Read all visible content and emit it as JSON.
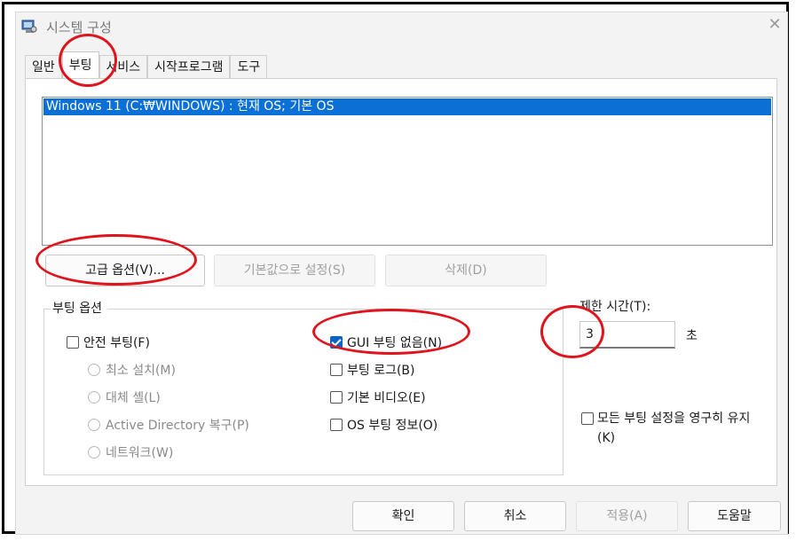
{
  "window": {
    "title": "시스템 구성"
  },
  "tabs": [
    "일반",
    "부팅",
    "서비스",
    "시작프로그램",
    "도구"
  ],
  "active_tab": "부팅",
  "os_list": {
    "items": [
      "Windows 11 (C:₩WINDOWS) : 현재 OS; 기본 OS"
    ]
  },
  "buttons": {
    "advanced": "고급 옵션(V)...",
    "set_default": "기본값으로 설정(S)",
    "delete": "삭제(D)"
  },
  "boot_options": {
    "label": "부팅 옵션",
    "safe_boot": "안전 부팅(F)",
    "minimal": "최소 설치(M)",
    "alternate_shell": "대체 셸(L)",
    "ad_repair": "Active Directory 복구(P)",
    "network": "네트워크(W)",
    "no_gui_boot": "GUI 부팅 없음(N)",
    "boot_log": "부팅 로그(B)",
    "base_video": "기본 비디오(E)",
    "os_boot_info": "OS 부팅 정보(O)"
  },
  "checked": {
    "safe_boot": false,
    "no_gui_boot": true,
    "boot_log": false,
    "base_video": false,
    "os_boot_info": false,
    "make_permanent": false
  },
  "timeout": {
    "label": "제한 시간(T):",
    "value": "3",
    "unit": "초"
  },
  "make_permanent": {
    "line1": "모든 부팅 설정을 영구히 유지",
    "line2": "(K)"
  },
  "footer": {
    "ok": "확인",
    "cancel": "취소",
    "apply": "적용(A)",
    "help": "도움말"
  },
  "colors": {
    "selection": "#0a70d6",
    "annotation": "#e0141c",
    "checkbox_checked": "#0a64c8"
  }
}
